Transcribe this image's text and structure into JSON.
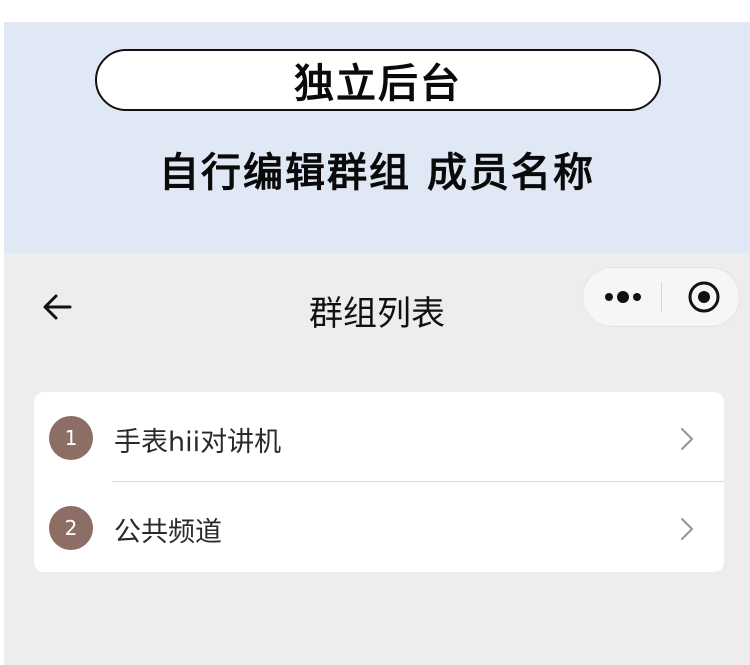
{
  "banner": {
    "pill_text": "独立后台",
    "subtitle": "自行编辑群组 成员名称"
  },
  "nav": {
    "title": "群组列表",
    "back_icon": "arrow-left-icon",
    "more_icon": "more-dots-icon",
    "close_icon": "target-circle-icon"
  },
  "list": {
    "items": [
      {
        "index": "1",
        "label": "手表hii对讲机"
      },
      {
        "index": "2",
        "label": "公共频道"
      }
    ]
  },
  "colors": {
    "banner_bg": "#dfe8f4",
    "page_bg": "#ededed",
    "badge": "#8c6e64"
  }
}
